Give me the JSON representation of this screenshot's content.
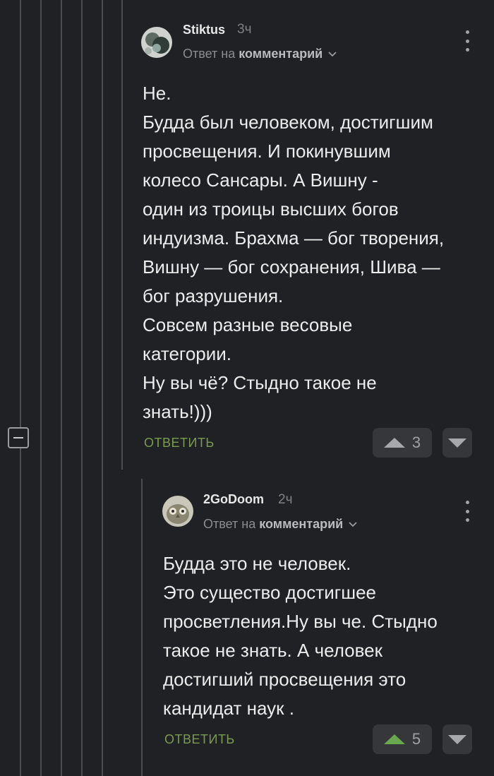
{
  "colors": {
    "background": "#202124",
    "thread_line": "#4a4c50",
    "reply_green": "#7a9a52",
    "upvote_active": "#6aa84f",
    "upvote_neutral": "#a6a8ac"
  },
  "comments": [
    {
      "author": "Stiktus",
      "time": "3ч",
      "reply_prefix": "Ответ на",
      "reply_link": "комментарий",
      "body": "Не.\nБудда был человеком, достигшим\nпросвещения. И покинувшим\nколесо Сансары. А Вишну -\nодин из троицы высших богов\nиндуизма. Брахма — бог творения,\nВишну — бог сохранения, Шива —\nбог разрушения.\nСовсем разные весовые\nкатегории.\nНу вы чё? Стыдно такое не\nзнать!)))",
      "reply_label": "ОТВЕТИТЬ",
      "rating": "3",
      "upvote_icon": "triangle-up-icon",
      "downvote_icon": "triangle-down-icon",
      "menu_icon": "more-vertical-icon"
    },
    {
      "author": "2GoDoom",
      "time": "2ч",
      "reply_prefix": "Ответ на",
      "reply_link": "комментарий",
      "body": "Будда это не человек.\nЭто существо достигшее\nпросветления.Ну вы че. Стыдно\nтакое не знать. А человек\nдостигший просвещения это\nкандидат наук .",
      "reply_label": "ОТВЕТИТЬ",
      "rating": "5",
      "upvote_icon": "triangle-up-icon",
      "downvote_icon": "triangle-down-icon",
      "menu_icon": "more-vertical-icon"
    }
  ],
  "thread": {
    "collapse_icon": "minus-square-icon"
  }
}
